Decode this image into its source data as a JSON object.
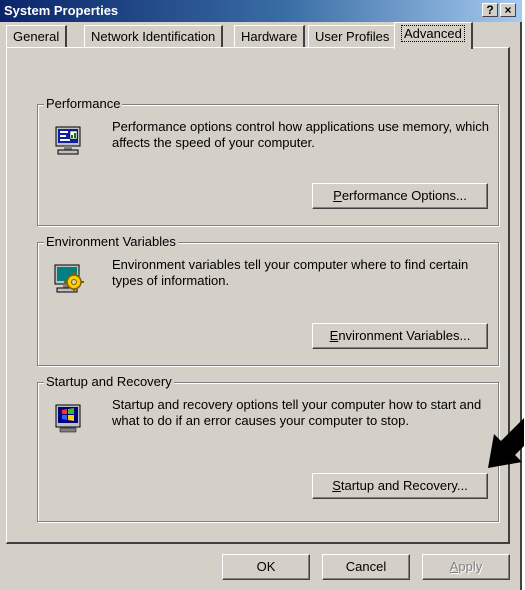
{
  "window": {
    "title": "System Properties",
    "help_button": "?",
    "close_button": "×"
  },
  "tabs": [
    {
      "label": "General"
    },
    {
      "label": "Network Identification"
    },
    {
      "label": "Hardware"
    },
    {
      "label": "User Profiles"
    },
    {
      "label": "Advanced"
    }
  ],
  "active_tab": "Advanced",
  "groups": {
    "performance": {
      "title": "Performance",
      "description": "Performance options control how applications use memory, which affects the speed of your computer.",
      "button": {
        "mnemonic": "P",
        "rest": "erformance Options..."
      },
      "icon": "performance-monitor-icon"
    },
    "environment": {
      "title": "Environment Variables",
      "description": "Environment variables tell your computer where to find certain types of information.",
      "button": {
        "mnemonic": "E",
        "rest": "nvironment Variables..."
      },
      "icon": "computer-gear-icon"
    },
    "startup": {
      "title": "Startup and Recovery",
      "description": "Startup and recovery options tell your computer how to start and what to do if an error causes your computer to stop.",
      "button": {
        "mnemonic": "S",
        "rest": "tartup and Recovery..."
      },
      "icon": "windows-startup-icon"
    }
  },
  "footer": {
    "ok": "OK",
    "cancel": "Cancel",
    "apply": {
      "mnemonic": "A",
      "rest": "pply"
    }
  },
  "annotation": {
    "icon": "pointer-arrow-icon"
  }
}
